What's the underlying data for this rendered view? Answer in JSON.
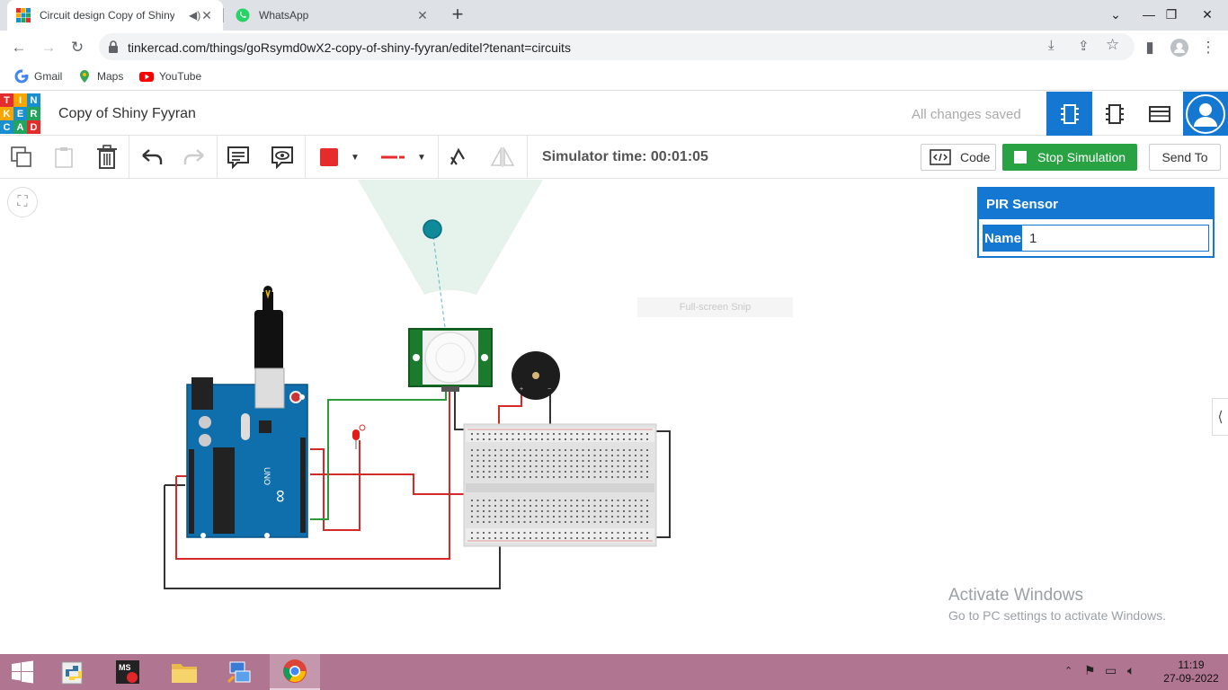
{
  "browser": {
    "tabs": [
      {
        "title": "Circuit design Copy of Shiny Fyyran",
        "active": true
      },
      {
        "title": "WhatsApp",
        "active": false
      }
    ],
    "new_tab": "+",
    "url": "tinkercad.com/things/goRsymd0wX2-copy-of-shiny-fyyran/editel?tenant=circuits",
    "bookmarks": [
      "Gmail",
      "Maps",
      "YouTube"
    ]
  },
  "header": {
    "logo_letters": [
      "T",
      "I",
      "N",
      "K",
      "E",
      "R",
      "C",
      "A",
      "D"
    ],
    "design_title": "Copy of Shiny Fyyran",
    "save_status": "All changes saved"
  },
  "toolbar": {
    "sim_time": "Simulator time: 00:01:05",
    "code_label": "Code",
    "stop_label": "Stop Simulation",
    "send_label": "Send To",
    "fill_color": "#e52b2b"
  },
  "inspector": {
    "title": "PIR Sensor",
    "name_label": "Name",
    "name_value": "1"
  },
  "overlays": {
    "snip": "Full-screen Snip",
    "activate_title": "Activate Windows",
    "activate_sub": "Go to PC settings to activate Windows."
  },
  "taskbar": {
    "time": "11:19",
    "date": "27-09-2022"
  },
  "colors": {
    "tinkercad_blue": "#1477d1",
    "sim_green": "#29a244",
    "taskbar": "#b07591"
  }
}
